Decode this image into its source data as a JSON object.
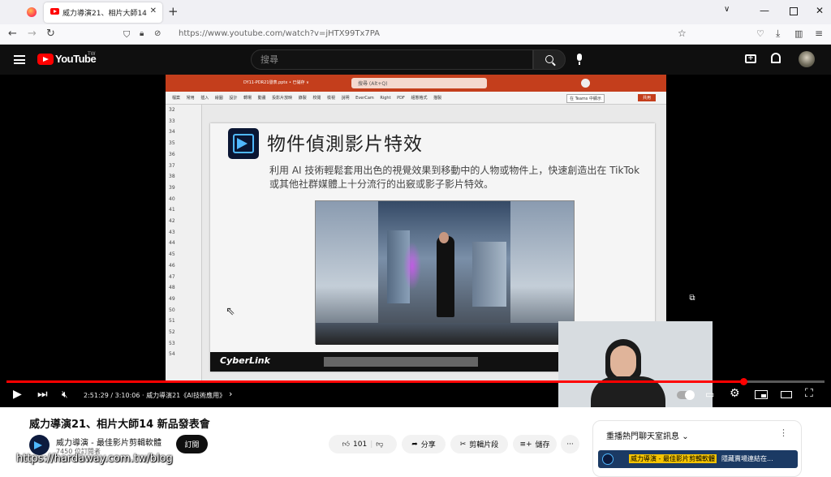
{
  "browser": {
    "tab_title": "威力導演21、相片大師14 新品...",
    "url": "https://www.youtube.com/watch?v=jHTX99Tx7PA"
  },
  "youtube": {
    "logo": "YouTube",
    "region": "TW",
    "search_placeholder": "搜尋"
  },
  "slide": {
    "title": "物件偵測影片特效",
    "body": "利用 AI 技術輕鬆套用出色的視覺效果到移動中的人物或物件上，快速創造出在 TikTok 或其他社群媒體上十分流行的出竅或影子影片特效。",
    "brand": "CyberLink",
    "ppt_search": "搜尋 (Alt+Q)",
    "ppt_file": "DY11-PDR21發表.pptx • 已儲存 ∨",
    "ppt_tabs": [
      "檔案",
      "常用",
      "插入",
      "繪圖",
      "設計",
      "轉場",
      "動畫",
      "投影片放映",
      "錄製",
      "校閱",
      "檢視",
      "說明",
      "EverCam",
      "Right PDF",
      "組態格式",
      "描製"
    ],
    "teams_btn": "在 Teams 中顯示",
    "share_btn": "共用",
    "row_numbers": [
      "32",
      "33",
      "34",
      "35",
      "36",
      "37",
      "38",
      "39",
      "40",
      "41",
      "42",
      "43",
      "44",
      "45",
      "46",
      "47",
      "48",
      "49",
      "50",
      "51",
      "52",
      "53",
      "54"
    ]
  },
  "player": {
    "time": "2:51:29 / 3:10:06 · 威力導演21《AI技術應用》",
    "progress_percent": 90.2
  },
  "video": {
    "title": "威力導演21、相片大師14 新品發表會",
    "channel": "威力導演 - 最佳影片剪輯軟體",
    "subscribers": "7450 位訂閱者",
    "subscribe_label": "訂閱",
    "likes": "101",
    "share_label": "分享",
    "clip_label": "剪輯片段",
    "save_label": "儲存"
  },
  "chat": {
    "header": "重播熱門聊天室訊息",
    "banner_name": "威力導演 - 最佳影片剪輯軟體",
    "banner_text": "隱藏賣場連結在..."
  },
  "watermark": "https://hardaway.com.tw/blog"
}
